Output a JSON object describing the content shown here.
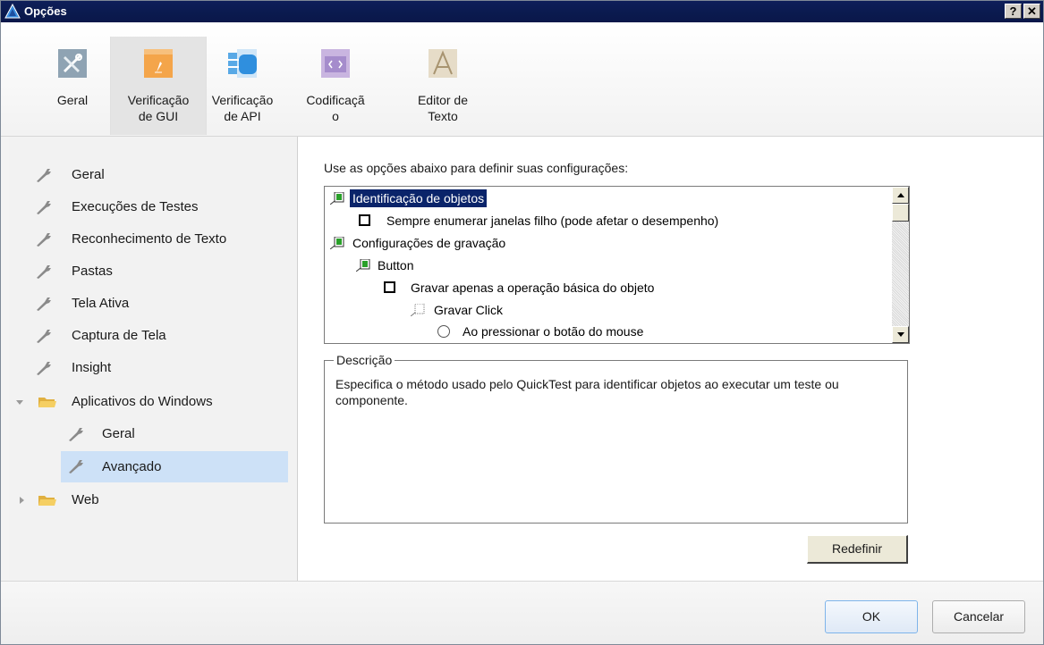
{
  "window": {
    "title": "Opções",
    "help_button": "?",
    "close_button": "✕"
  },
  "ribbon": {
    "tabs": [
      {
        "label": "Geral",
        "icon": "tools-icon",
        "selected": false
      },
      {
        "label": "Verificação\nde GUI",
        "icon": "gui-icon",
        "selected": true
      },
      {
        "label": "Verificação\nde API",
        "icon": "api-icon",
        "selected": false
      },
      {
        "label": "Codificaçã\no",
        "icon": "code-icon",
        "selected": false
      },
      {
        "label": "Editor de\nTexto",
        "icon": "text-editor-icon",
        "selected": false
      }
    ]
  },
  "sidebar": {
    "items": [
      {
        "label": "Geral",
        "icon": "wrench-icon"
      },
      {
        "label": "Execuções de Testes",
        "icon": "wrench-icon"
      },
      {
        "label": "Reconhecimento de Texto",
        "icon": "wrench-icon"
      },
      {
        "label": "Pastas",
        "icon": "wrench-icon"
      },
      {
        "label": "Tela Ativa",
        "icon": "wrench-icon"
      },
      {
        "label": "Captura de Tela",
        "icon": "wrench-icon"
      },
      {
        "label": "Insight",
        "icon": "wrench-icon"
      },
      {
        "label": "Aplicativos do Windows",
        "icon": "folder-open-icon",
        "expanded": true
      },
      {
        "label": "Geral",
        "icon": "wrench-icon",
        "child": true
      },
      {
        "label": "Avançado",
        "icon": "wrench-icon",
        "child": true,
        "selected": true
      },
      {
        "label": "Web",
        "icon": "folder-icon",
        "expanded": false
      }
    ]
  },
  "main": {
    "instruction": "Use as opções abaixo para definir suas configurações:",
    "options": [
      {
        "label": "Identificação de objetos",
        "kind": "group",
        "selected": true
      },
      {
        "label": "Sempre enumerar janelas filho (pode afetar o desempenho)",
        "kind": "checkbox",
        "checked": false
      },
      {
        "label": "Configurações de gravação",
        "kind": "group"
      },
      {
        "label": "Button",
        "kind": "group"
      },
      {
        "label": "Gravar apenas a operação básica do objeto",
        "kind": "checkbox",
        "checked": false
      },
      {
        "label": "Gravar Click",
        "kind": "subgroup"
      },
      {
        "label": "Ao pressionar o botão do mouse",
        "kind": "radio"
      }
    ],
    "description_legend": "Descrição",
    "description_text": "Especifica o método usado pelo QuickTest para identificar objetos ao executar um teste ou componente.",
    "reset_label": "Redefinir"
  },
  "footer": {
    "ok_label": "OK",
    "cancel_label": "Cancelar"
  },
  "colors": {
    "titlebar": "#0a1a4e",
    "selection": "#0a246a",
    "nav_selected": "#cde1f7"
  }
}
